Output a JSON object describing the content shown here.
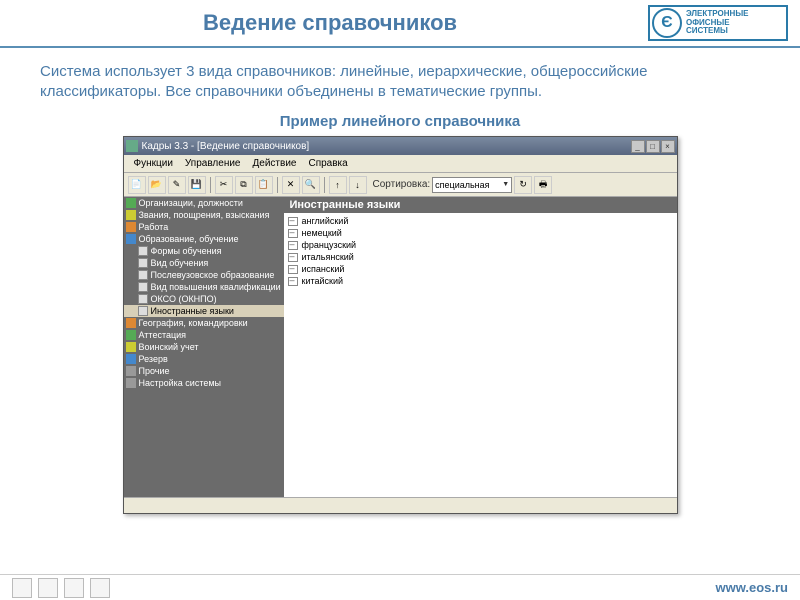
{
  "slide": {
    "title": "Ведение справочников",
    "logo_lines": [
      "ЭЛЕКТРОННЫЕ",
      "ОФИСНЫЕ",
      "СИСТЕМЫ"
    ],
    "logo_mark": "Є",
    "description": "Система использует 3 вида справочников: линейные, иерархические, общероссийские классификаторы. Все справочники объединены в тематические группы.",
    "example_title": "Пример линейного справочника",
    "footer_url": "www.eos.ru"
  },
  "app": {
    "title": "Кадры 3.3 - [Ведение справочников]",
    "menu": [
      "Функции",
      "Управление",
      "Действие",
      "Справка"
    ],
    "toolbar": {
      "sort_label": "Сортировка:",
      "sort_value": "специальная"
    },
    "tree": [
      {
        "label": "Организации, должности",
        "cls": "ti-green"
      },
      {
        "label": "Звания, поощрения, взыскания",
        "cls": "ti-yellow"
      },
      {
        "label": "Работа",
        "cls": "ti-orange"
      },
      {
        "label": "Образование, обучение",
        "cls": "ti-blue"
      },
      {
        "label": "Формы обучения",
        "cls": "ti-doc",
        "child": true
      },
      {
        "label": "Вид обучения",
        "cls": "ti-doc",
        "child": true
      },
      {
        "label": "Послевузовское образование",
        "cls": "ti-doc",
        "child": true
      },
      {
        "label": "Вид повышения квалификации",
        "cls": "ti-doc",
        "child": true
      },
      {
        "label": "ОКСО (ОКНПО)",
        "cls": "ti-doc",
        "child": true
      },
      {
        "label": "Иностранные языки",
        "cls": "ti-doc",
        "child": true,
        "selected": true
      },
      {
        "label": "География, командировки",
        "cls": "ti-orange"
      },
      {
        "label": "Аттестация",
        "cls": "ti-green"
      },
      {
        "label": "Воинский учет",
        "cls": "ti-yellow"
      },
      {
        "label": "Резерв",
        "cls": "ti-blue"
      },
      {
        "label": "Прочие",
        "cls": "ti-gray"
      },
      {
        "label": "Настройка системы",
        "cls": "ti-gray"
      }
    ],
    "panel_title": "Иностранные языки",
    "list": [
      "английский",
      "немецкий",
      "французский",
      "итальянский",
      "испанский",
      "китайский"
    ]
  }
}
